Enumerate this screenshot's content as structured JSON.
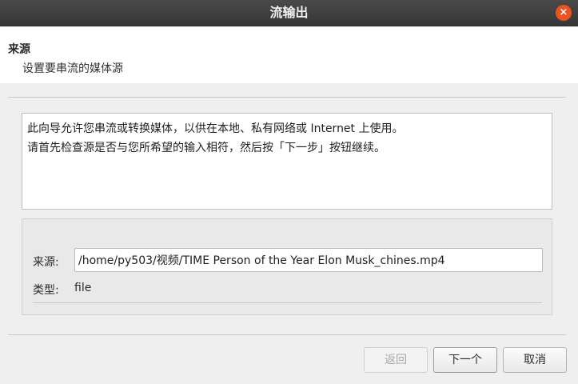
{
  "window": {
    "title": "流输出",
    "close_glyph": "×"
  },
  "header": {
    "title": "来源",
    "subtitle": "设置要串流的媒体源"
  },
  "description": {
    "line1": "此向导允许您串流或转换媒体，以供在本地、私有网络或 Internet 上使用。",
    "line2": "请首先检查源是否与您所希望的输入相符，然后按「下一步」按钮继续。"
  },
  "source": {
    "label": "来源:",
    "value": "/home/py503/视频/TIME Person of the Year Elon Musk_chines.mp4",
    "type_label": "类型:",
    "type_value": "file"
  },
  "buttons": {
    "back": "返回",
    "next": "下一个",
    "cancel": "取消"
  },
  "colors": {
    "titlebar": "#3c3c3c",
    "close_accent": "#e95420"
  }
}
